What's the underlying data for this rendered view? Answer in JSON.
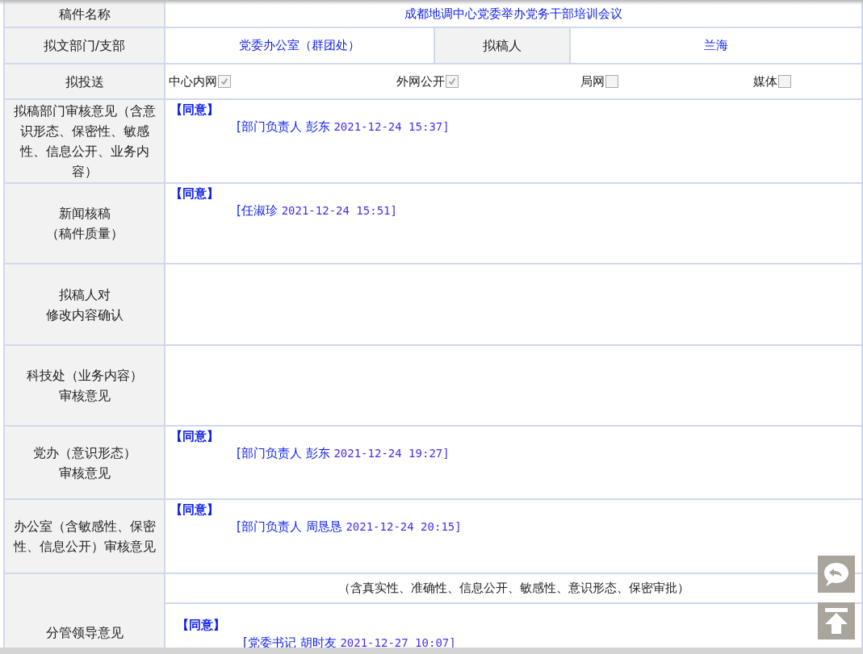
{
  "form": {
    "rows": [
      {
        "kind": "title",
        "label": "稿件名称",
        "value": "成都地调中心党委举办党务干部培训会议"
      },
      {
        "kind": "pair",
        "label": "拟文部门/支部",
        "value": "党委办公室（群团处）",
        "label_2": "拟稿人",
        "value_2": "兰海"
      },
      {
        "kind": "checks",
        "label": "拟投送",
        "options": [
          {
            "label": "中心内网",
            "checked": true
          },
          {
            "label": "外网公开",
            "checked": true
          },
          {
            "label": "局网",
            "checked": false
          },
          {
            "label": "媒体",
            "checked": false
          }
        ]
      },
      {
        "kind": "review",
        "label": "拟稿部门审核意见（含意识形态、保密性、敏感性、信息公开、业务内容）",
        "opinion": "【同意】",
        "signer": "[部门负责人 彭东",
        "time": "2021-12-24 15:37]"
      },
      {
        "kind": "review",
        "label": [
          "新闻核稿",
          "（稿件质量）"
        ],
        "opinion": "【同意】",
        "signer": "[任淑珍",
        "time": "2021-12-24 15:51]"
      },
      {
        "kind": "review",
        "label": [
          "拟稿人对",
          "修改内容确认"
        ]
      },
      {
        "kind": "review",
        "label": [
          "科技处（业务内容）",
          "审核意见"
        ]
      },
      {
        "kind": "review",
        "label": [
          "党办（意识形态）",
          "审核意见"
        ],
        "opinion": "【同意】",
        "signer": "[部门负责人 彭东",
        "time": "2021-12-24 19:27]"
      },
      {
        "kind": "review",
        "label": "办公室（含敏感性、保密性、信息公开）审核意见",
        "opinion": "【同意】",
        "signer": "[部门负责人 周恳恳",
        "time": "2021-12-24 20:15]"
      },
      {
        "kind": "leader",
        "label": "分管领导意见",
        "note": "（含真实性、准确性、信息公开、敏感性、意识形态、保密审批）",
        "opinion": "【同意】",
        "signer": "[党委书记 胡时友",
        "time": "2021-12-27 10:07]"
      }
    ]
  },
  "float_buttons": [
    {
      "kind": "reply"
    },
    {
      "kind": "top"
    }
  ]
}
